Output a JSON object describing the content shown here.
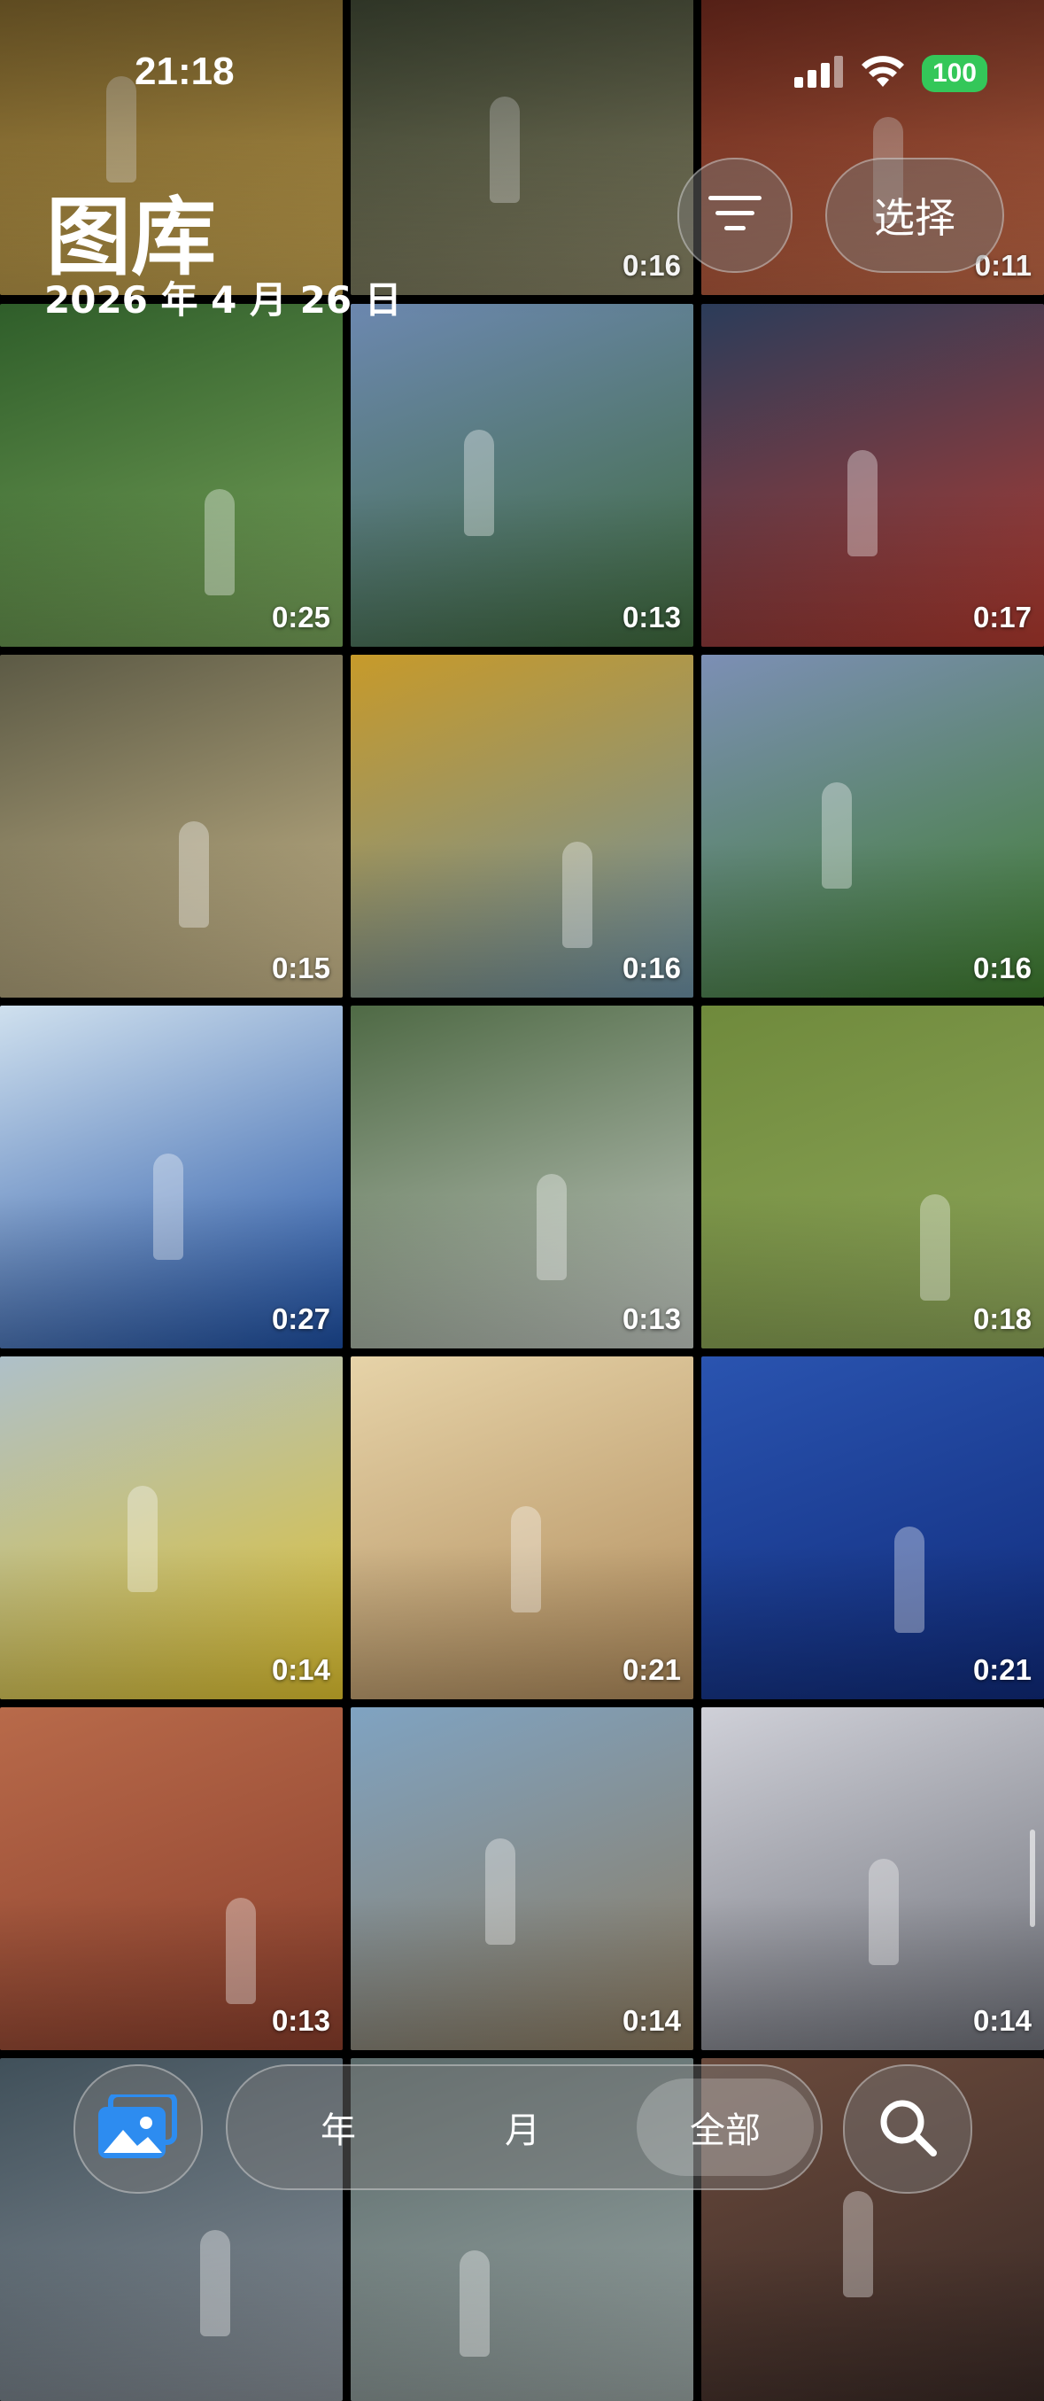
{
  "status_bar": {
    "time": "21:18",
    "battery": "100"
  },
  "header": {
    "title": "图库",
    "date": "2026 年 4 月 26 日"
  },
  "toolbar": {
    "select_label": "选择"
  },
  "tiles": [
    {
      "duration": "",
      "colors": [
        "#8a6d2f",
        "#c8a651"
      ]
    },
    {
      "duration": "0:16",
      "colors": [
        "#3f4a35",
        "#8f8a6a"
      ]
    },
    {
      "duration": "0:11",
      "colors": [
        "#7a2a1e",
        "#c66c48"
      ]
    },
    {
      "duration": "0:25",
      "colors": [
        "#2f5e2a",
        "#78a35a"
      ]
    },
    {
      "duration": "0:13",
      "colors": [
        "#6c88b0",
        "#3f6a3c"
      ]
    },
    {
      "duration": "0:17",
      "colors": [
        "#2b3c5a",
        "#b23a2e"
      ]
    },
    {
      "duration": "0:15",
      "colors": [
        "#5c5a45",
        "#c8b78a"
      ]
    },
    {
      "duration": "0:16",
      "colors": [
        "#c79a2a",
        "#6a8fa4"
      ]
    },
    {
      "duration": "0:16",
      "colors": [
        "#7c8fb5",
        "#3f7d2e"
      ]
    },
    {
      "duration": "0:27",
      "colors": [
        "#cfe0ee",
        "#1d4fa3"
      ]
    },
    {
      "duration": "0:13",
      "colors": [
        "#4f6a45",
        "#c3c9c2"
      ]
    },
    {
      "duration": "0:18",
      "colors": [
        "#6f8a3c",
        "#8ea65a"
      ]
    },
    {
      "duration": "0:14",
      "colors": [
        "#aec0c9",
        "#e0c22e"
      ]
    },
    {
      "duration": "0:21",
      "colors": [
        "#e6d3a8",
        "#b08b5b"
      ]
    },
    {
      "duration": "0:21",
      "colors": [
        "#2a54b0",
        "#0f2a7a"
      ]
    },
    {
      "duration": "0:13",
      "colors": [
        "#b86a4a",
        "#8a3e2c"
      ]
    },
    {
      "duration": "0:14",
      "colors": [
        "#7fa3c2",
        "#8c7a5e"
      ]
    },
    {
      "duration": "0:14",
      "colors": [
        "#cfd0d8",
        "#6e7078"
      ]
    },
    {
      "duration": "",
      "colors": [
        "#40505a",
        "#8a929a"
      ]
    },
    {
      "duration": "",
      "colors": [
        "#5a6a6a",
        "#9aa6a4"
      ]
    },
    {
      "duration": "",
      "colors": [
        "#6a4a3c",
        "#3a2a26"
      ]
    }
  ],
  "tabbar": {
    "year": "年",
    "month": "月",
    "all": "全部"
  },
  "icons": {
    "signal": "cellular-signal-icon",
    "wifi": "wifi-icon",
    "sort": "sort-filter-icon",
    "photos": "photos-library-icon",
    "search": "search-icon"
  },
  "colors": {
    "battery_green": "#34c759",
    "accent_blue": "#2d8cf0"
  }
}
